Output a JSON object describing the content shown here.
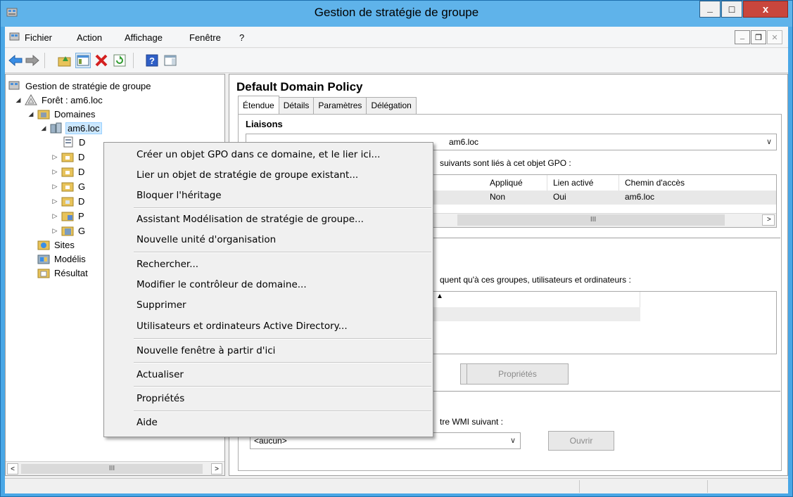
{
  "window": {
    "title": "Gestion de stratégie de groupe",
    "minimize_glyph": "_",
    "maximize_glyph": "□",
    "close_glyph": "x"
  },
  "menubar": {
    "items": [
      "Fichier",
      "Action",
      "Affichage",
      "Fenêtre",
      "?"
    ]
  },
  "tree": {
    "root": "Gestion de stratégie de groupe",
    "forest": "Forêt : am6.loc",
    "domains": "Domaines",
    "domain": "am6.loc",
    "child_initials": [
      "D",
      "D",
      "D",
      "G",
      "D",
      "P",
      "G"
    ],
    "sites": "Sites",
    "modeling": "Modélis",
    "results": "Résultat"
  },
  "detail": {
    "title": "Default Domain Policy",
    "tabs": [
      "Étendue",
      "Détails",
      "Paramètres",
      "Délégation"
    ],
    "links_section": "Liaisons",
    "links_combo_value": "am6.loc",
    "links_desc": "suivants sont liés à cet objet GPO :",
    "links_headers": [
      "Appliqué",
      "Lien activé",
      "Chemin d'accès"
    ],
    "links_row": [
      "Non",
      "Oui",
      "am6.loc"
    ],
    "filter_desc": "quent qu'à ces groupes, utilisateurs et ordinateurs :",
    "properties_button": "Propriétés",
    "wmi_desc": "tre WMI suivant :",
    "wmi_combo_value": "<aucun>",
    "open_button": "Ouvrir"
  },
  "context_menu": {
    "items": [
      "Créer un objet GPO dans ce domaine, et le lier ici...",
      "Lier un objet de stratégie de groupe existant...",
      "Bloquer l'héritage",
      "Assistant Modélisation de stratégie de groupe...",
      "Nouvelle unité d'organisation",
      "Rechercher...",
      "Modifier le contrôleur de domaine...",
      "Supprimer",
      "Utilisateurs et ordinateurs Active Directory...",
      "Nouvelle fenêtre à partir d'ici",
      "Actualiser",
      "Propriétés",
      "Aide"
    ]
  },
  "colors": {
    "title_bar": "#5fb3ea",
    "close_button": "#c9463d",
    "selection": "#cce8ff"
  }
}
